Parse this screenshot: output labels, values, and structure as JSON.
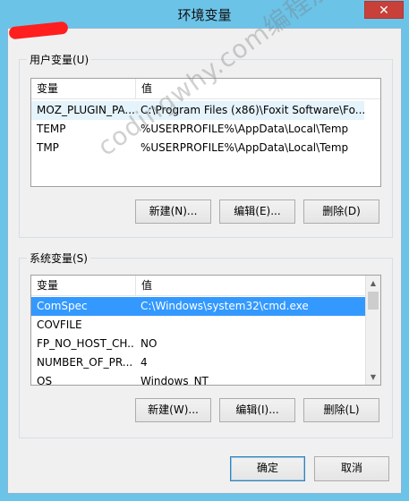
{
  "window": {
    "title": "环境变量",
    "close_glyph": "✕"
  },
  "user_vars": {
    "legend": "用户变量(U)",
    "headers": [
      "变量",
      "值"
    ],
    "rows": [
      {
        "name": "MOZ_PLUGIN_PA...",
        "value": "C:\\Program Files (x86)\\Foxit Software\\Fo..."
      },
      {
        "name": "TEMP",
        "value": "%USERPROFILE%\\AppData\\Local\\Temp"
      },
      {
        "name": "TMP",
        "value": "%USERPROFILE%\\AppData\\Local\\Temp"
      }
    ],
    "buttons": {
      "new": "新建(N)...",
      "edit": "编辑(E)...",
      "delete": "删除(D)"
    }
  },
  "system_vars": {
    "legend": "系统变量(S)",
    "headers": [
      "变量",
      "值"
    ],
    "rows": [
      {
        "name": "ComSpec",
        "value": "C:\\Windows\\system32\\cmd.exe",
        "selected": true
      },
      {
        "name": "COVFILE",
        "value": ""
      },
      {
        "name": "FP_NO_HOST_CH...",
        "value": "NO"
      },
      {
        "name": "NUMBER_OF_PR...",
        "value": "4"
      },
      {
        "name": "OS",
        "value": "Windows_NT"
      }
    ],
    "buttons": {
      "new": "新建(W)...",
      "edit": "编辑(I)...",
      "delete": "删除(L)"
    }
  },
  "dialog_buttons": {
    "ok": "确定",
    "cancel": "取消"
  },
  "watermark": "codingwhy.com编程那点事",
  "colors": {
    "selection": "#3399ff",
    "title_bar": "#6cc3e8",
    "close": "#c7403a"
  }
}
